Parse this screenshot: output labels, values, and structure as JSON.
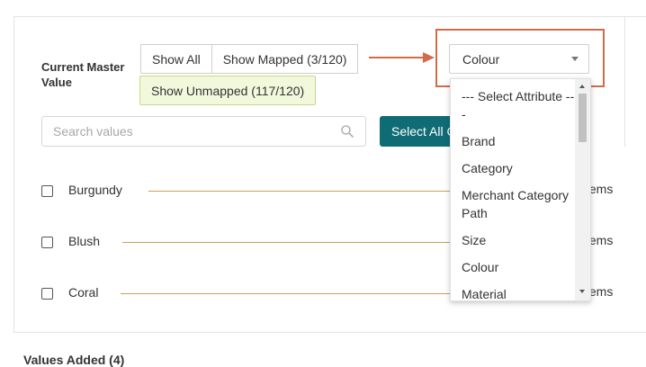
{
  "panel": {
    "current_master_label": "Current Master Value",
    "filters": {
      "show_all": "Show All",
      "show_mapped": "Show Mapped (3/120)",
      "show_unmapped": "Show Unmapped (117/120)"
    },
    "search": {
      "placeholder": "Search values",
      "value": ""
    },
    "select_all_label": "Select All C",
    "rows": [
      {
        "name": "Burgundy",
        "items_label": "tems"
      },
      {
        "name": "Blush",
        "items_label": "tems"
      },
      {
        "name": "Coral",
        "items_label": "tems"
      }
    ]
  },
  "attribute_select": {
    "selected": "Colour",
    "options": [
      "--- Select Attribute ---",
      "Brand",
      "Category",
      "Merchant Category Path",
      "Size",
      "Colour",
      "Material"
    ]
  },
  "values_added_label": "Values Added (4)",
  "colors": {
    "accent": "#0f6c74",
    "highlight": "#d46a47",
    "unmapped_bg": "#f2f8dc",
    "connector_line": "#c9a14e"
  }
}
